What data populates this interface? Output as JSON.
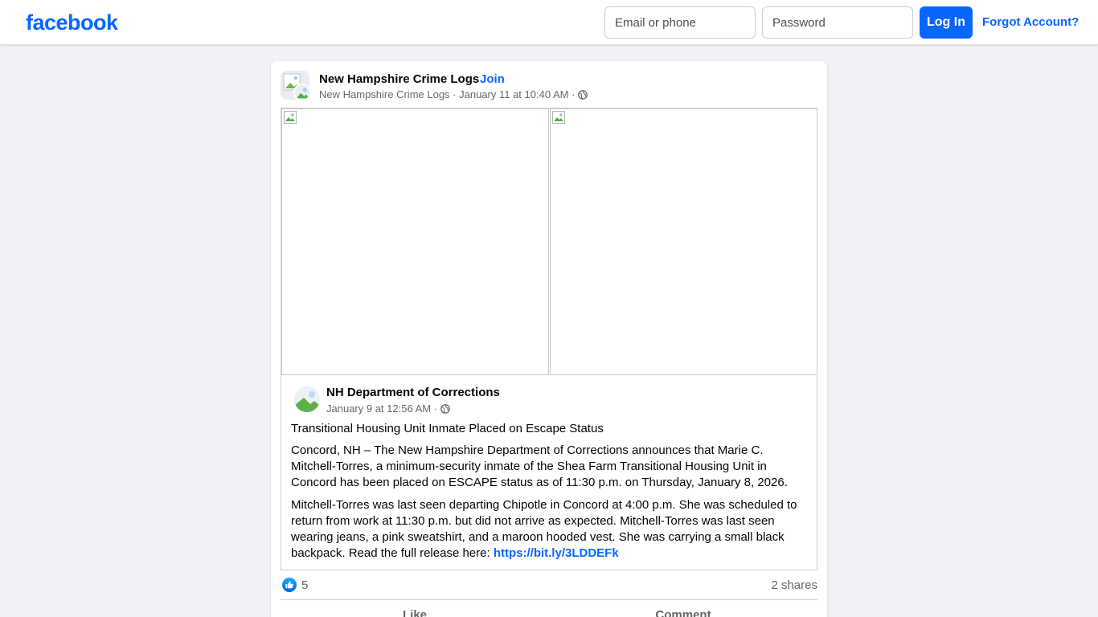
{
  "header": {
    "logo_text": "facebook",
    "email_placeholder": "Email or phone",
    "password_placeholder": "Password",
    "login_label": "Log In",
    "forgot_label": "Forgot Account?"
  },
  "post": {
    "group_name": "New Hampshire Crime Logs",
    "separator": "·",
    "join_label": "Join",
    "meta": "New Hampshire Crime Logs · January 11 at 10:40 AM ·",
    "shared": {
      "author": "NH Department of Corrections",
      "meta": "January 9 at 12:56 AM ·",
      "title": "Transitional Housing Unit Inmate Placed on Escape Status",
      "paragraph1": "Concord, NH – The New Hampshire Department of Corrections announces that Marie C. Mitchell-Torres, a minimum-security inmate of the Shea Farm Transitional Housing Unit in Concord has been placed on ESCAPE status as of 11:30 p.m. on Thursday, January 8, 2026.",
      "paragraph2": "Mitchell-Torres was last seen departing Chipotle in Concord at 4:00 p.m. She was scheduled to return from work at 11:30 p.m. but did not arrive as expected. Mitchell-Torres was last seen wearing jeans, a pink sweatshirt, and a maroon hooded vest. She was carrying a small black backpack. Read the full release here:",
      "link_text": "https://bit.ly/3LDDEFk"
    },
    "like_count": "5",
    "shares": "2 shares",
    "actions": {
      "like": "Like",
      "comment": "Comment"
    }
  },
  "colors": {
    "brand": "#0866ff",
    "background": "#f0f2f5",
    "secondary_text": "#65676b"
  }
}
